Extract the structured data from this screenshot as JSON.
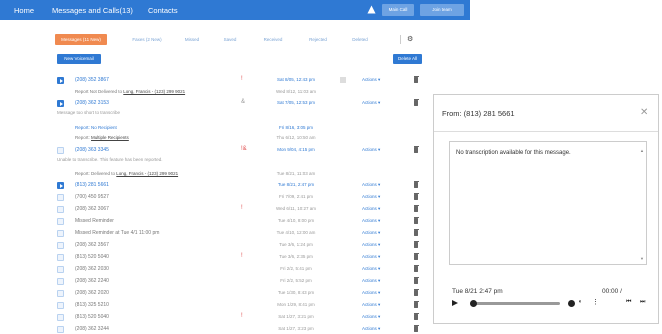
{
  "nav": {
    "home": "Home",
    "messages": "Messages and Calls(13)",
    "contacts": "Contacts",
    "main_call": "Main Call",
    "join_team": "Join team"
  },
  "tabs": [
    {
      "label": "Messages (11 New)",
      "active": true
    },
    {
      "label": "Faxes (2 New)"
    },
    {
      "label": "Missed"
    },
    {
      "label": "Saved"
    },
    {
      "label": "Received"
    },
    {
      "label": "Rejected"
    },
    {
      "label": "Deleted"
    }
  ],
  "toolbar": {
    "new_label": "New Voicemail",
    "delete_all": "Delete All"
  },
  "rows": [
    {
      "type": "play",
      "number": "(208) 352 3867",
      "blue": true,
      "mark": "!",
      "date": "Sat 8/05, 12:43 pm",
      "date_blue": true,
      "sq": true
    },
    {
      "type": "play",
      "number": "(208) 362 3153",
      "blue": true,
      "mark": "&",
      "mark_gray": true,
      "date": "Sat 7/05, 12:53 pm",
      "date_blue": true
    },
    {
      "type": "check",
      "number": "(208) 363 3345",
      "blue": true,
      "mark": "!&",
      "date": "Mon 9/04, 4:15 pm",
      "date_blue": true
    },
    {
      "type": "play",
      "number": "(813) 281 5661",
      "blue": true,
      "date": "Tue 8/21, 2:47 pm",
      "date_blue": true
    },
    {
      "type": "check",
      "number": "(700) 450 9527",
      "date": "Fri 7/09, 2:41 pm"
    },
    {
      "type": "check",
      "number": "(208) 362 3067",
      "mark": "!",
      "date": "Wed 6/11, 10:27 am"
    },
    {
      "type": "check",
      "number": "Missed Reminder",
      "date": "Tue 4/10, 8:00 pm"
    },
    {
      "type": "check",
      "number": "Missed Reminder at Tue 4/1 11:00 pm",
      "date": "Tue 4/10, 12:00 am"
    },
    {
      "type": "check",
      "number": "(208) 362 3567",
      "date": "Tue 3/6, 1:24 pm"
    },
    {
      "type": "check",
      "number": "(813) 520 5040",
      "mark": "!",
      "date": "Tue 3/6, 2:35 pm"
    },
    {
      "type": "check",
      "number": "(208) 362 2030",
      "date": "Fri 2/2, 5:41 pm"
    },
    {
      "type": "check",
      "number": "(208) 362 2240",
      "date": "Fri 2/2, 5:52 pm"
    },
    {
      "type": "check",
      "number": "(208) 362 2020",
      "date": "Tue 1/30, 8:43 pm"
    },
    {
      "type": "check",
      "number": "(813) 325 5210",
      "date": "Mon 1/29, 8:41 pm"
    },
    {
      "type": "check",
      "number": "(813) 520 5040",
      "mark": "!",
      "date": "Sat 1/27, 3:21 pm"
    },
    {
      "type": "check",
      "number": "(208) 362 3244",
      "date": "Sat 1/27, 3:23 pm"
    }
  ],
  "actions_label": "Actions ▾",
  "sublines": {
    "report1": "Report Not Delivered to",
    "report1_link": "Long, Francis - (123) 299 9021",
    "note1": "Message too short to transcribe",
    "report2": "Report: No Recipient",
    "report2_date": "Fri 8/16, 3:05 pm",
    "report3": "Report:",
    "report3_link": "Multiple Recipients",
    "report3_date": "Thu 6/12, 10:50 am",
    "note2": "Unable to transcribe. This feature has been reported.",
    "report4": "Report: Delivered to",
    "report4_link": "Long, Francis - (123) 299 9021",
    "report4_date": "Tue 8/21, 11:03 am",
    "report1_date": "Wed 8/12, 11:03 am"
  },
  "panel": {
    "from": "From: (813) 281 5661",
    "transcript": "No transcription available for this message.",
    "timestamp": "Tue 8/21 2:47 pm",
    "time": "00:00 /"
  }
}
